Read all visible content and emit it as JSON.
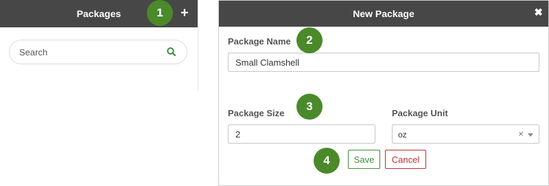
{
  "left_panel": {
    "title": "Packages",
    "add_icon": "plus-icon",
    "search": {
      "placeholder": "Search",
      "icon": "search-icon"
    }
  },
  "modal": {
    "title": "New Package",
    "close_icon": "close-icon",
    "package_name": {
      "label": "Package Name",
      "value": "Small Clamshell"
    },
    "package_size": {
      "label": "Package Size",
      "value": "2"
    },
    "package_unit": {
      "label": "Package Unit",
      "value": "oz"
    },
    "buttons": {
      "save": "Save",
      "cancel": "Cancel"
    }
  },
  "badges": [
    "1",
    "2",
    "3",
    "4"
  ],
  "colors": {
    "header_bg": "#474747",
    "badge_green": "#4a8a2a",
    "save_green": "#3d8b3d",
    "cancel_red": "#c12c2c",
    "search_icon_green": "#3d8b3d"
  }
}
